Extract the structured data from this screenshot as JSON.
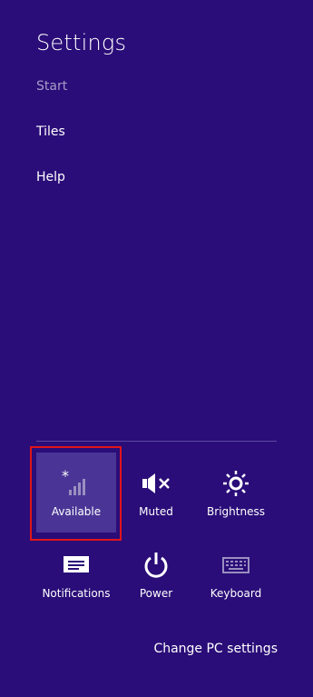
{
  "panel": {
    "title": "Settings",
    "items": [
      {
        "label": "Start"
      },
      {
        "label": "Tiles"
      },
      {
        "label": "Help"
      }
    ]
  },
  "quick_settings": [
    {
      "label": "Available",
      "icon": "network-available-icon",
      "active": true
    },
    {
      "label": "Muted",
      "icon": "speaker-muted-icon"
    },
    {
      "label": "Brightness",
      "icon": "brightness-icon"
    },
    {
      "label": "Notifications",
      "icon": "notifications-icon"
    },
    {
      "label": "Power",
      "icon": "power-icon"
    },
    {
      "label": "Keyboard",
      "icon": "keyboard-icon"
    }
  ],
  "footer": {
    "change_pc_settings": "Change PC settings"
  },
  "colors": {
    "background": "#2a0d78",
    "active_tile": "#4a3596",
    "highlight": "#e0141b"
  }
}
